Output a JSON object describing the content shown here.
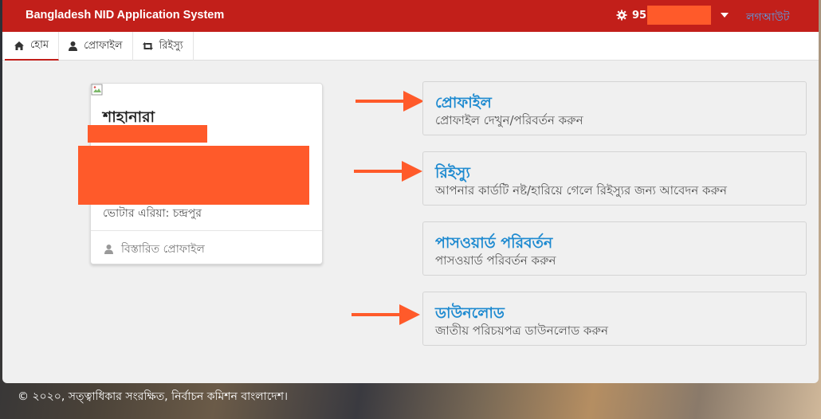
{
  "header": {
    "brand": "Bangladesh NID Application System",
    "user_id_prefix": "95",
    "logout_label": "লগআউট"
  },
  "nav": {
    "tabs": [
      {
        "label": "হোম",
        "icon": "home-icon"
      },
      {
        "label": "প্রোফাইল",
        "icon": "user-icon"
      },
      {
        "label": "রিইস্যু",
        "icon": "retweet-icon"
      }
    ]
  },
  "profile": {
    "name": "শাহানারা",
    "voter_area": "ভোটার এরিয়া: চন্দ্রপুর",
    "details_link": "বিস্তারিত প্রোফাইল"
  },
  "actions": [
    {
      "title": "প্রোফাইল",
      "desc": "প্রোফাইল দেখুন/পরিবর্তন করুন"
    },
    {
      "title": "রিইস্যু",
      "desc": "আপনার কার্ডটি নষ্ট/হারিয়ে গেলে রিইস্যুর জন্য আবেদন করুন"
    },
    {
      "title": "পাসওয়ার্ড পরিবর্তন",
      "desc": "পাসওয়ার্ড পরিবর্তন করুন"
    },
    {
      "title": "ডাউনলোড",
      "desc": "জাতীয় পরিচয়পত্র ডাউনলোড করুন"
    }
  ],
  "footer": {
    "text": "© ২০২০, সত্ত্বাধিকার সংরক্ষিত, নির্বাচন কমিশন বাংলাদেশ।"
  },
  "colors": {
    "topbar": "#c21f1a",
    "link_blue": "#1e8ad0",
    "annotation_orange": "#ff5a2a"
  }
}
